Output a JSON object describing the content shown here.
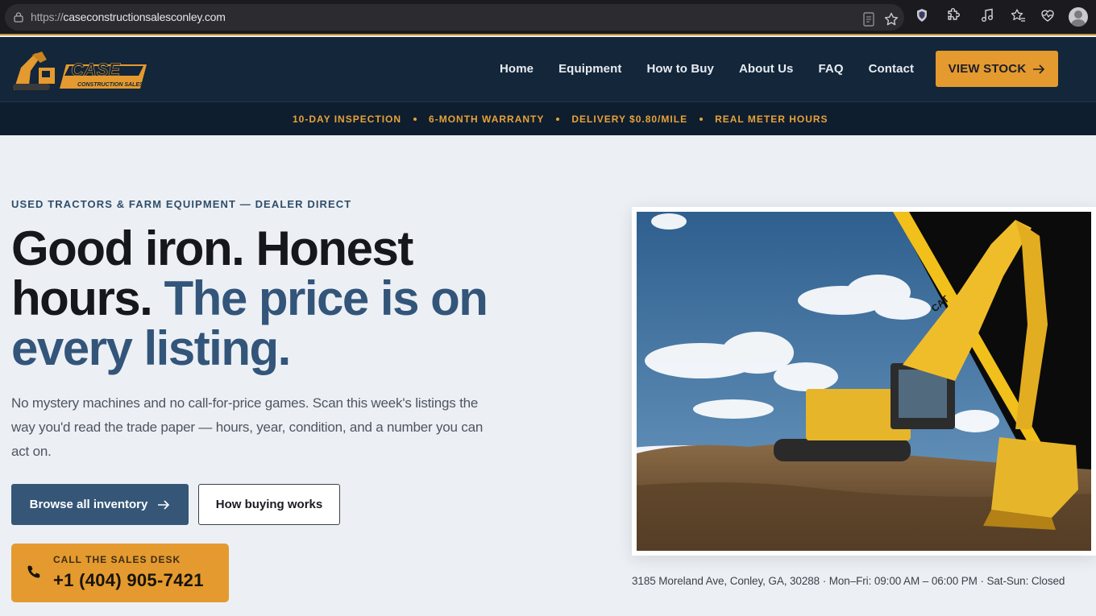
{
  "browser": {
    "url_scheme": "https://",
    "url_host": "caseconstructionsalesconley.com"
  },
  "header": {
    "logo_text": "CASE",
    "logo_subtext": "CONSTRUCTION SALES",
    "nav": [
      "Home",
      "Equipment",
      "How to Buy",
      "About Us",
      "FAQ",
      "Contact"
    ],
    "cta_label": "VIEW STOCK"
  },
  "strip": {
    "items": [
      "10-DAY INSPECTION",
      "6-MONTH WARRANTY",
      "DELIVERY $0.80/MILE",
      "REAL METER HOURS"
    ]
  },
  "hero": {
    "eyebrow": "USED TRACTORS & FARM EQUIPMENT — DEALER DIRECT",
    "headline_part1": "Good iron. Honest hours.",
    "headline_part2": "The price is on every listing.",
    "lead": "No mystery machines and no call-for-price games. Scan this week's listings the way you'd read the trade paper — hours, year, condition, and a number you can act on.",
    "btn_primary": "Browse all inventory",
    "btn_secondary": "How buying works",
    "call_label": "CALL THE SALES DESK",
    "call_phone": "+1 (404) 905-7421",
    "address": "3185 Moreland Ave, Conley, GA, 30288 · Mon–Fri: 09:00 AM – 06:00 PM · Sat-Sun: Closed"
  },
  "colors": {
    "navy": "#13263a",
    "orange": "#e49a2e",
    "accent_blue": "#33557a"
  },
  "icons": [
    "lock-icon",
    "reader-icon",
    "star-icon",
    "shield-icon",
    "extension-icon",
    "music-icon",
    "favorites-icon",
    "heartbeat-icon",
    "profile-icon",
    "arrow-right-icon",
    "phone-icon"
  ]
}
